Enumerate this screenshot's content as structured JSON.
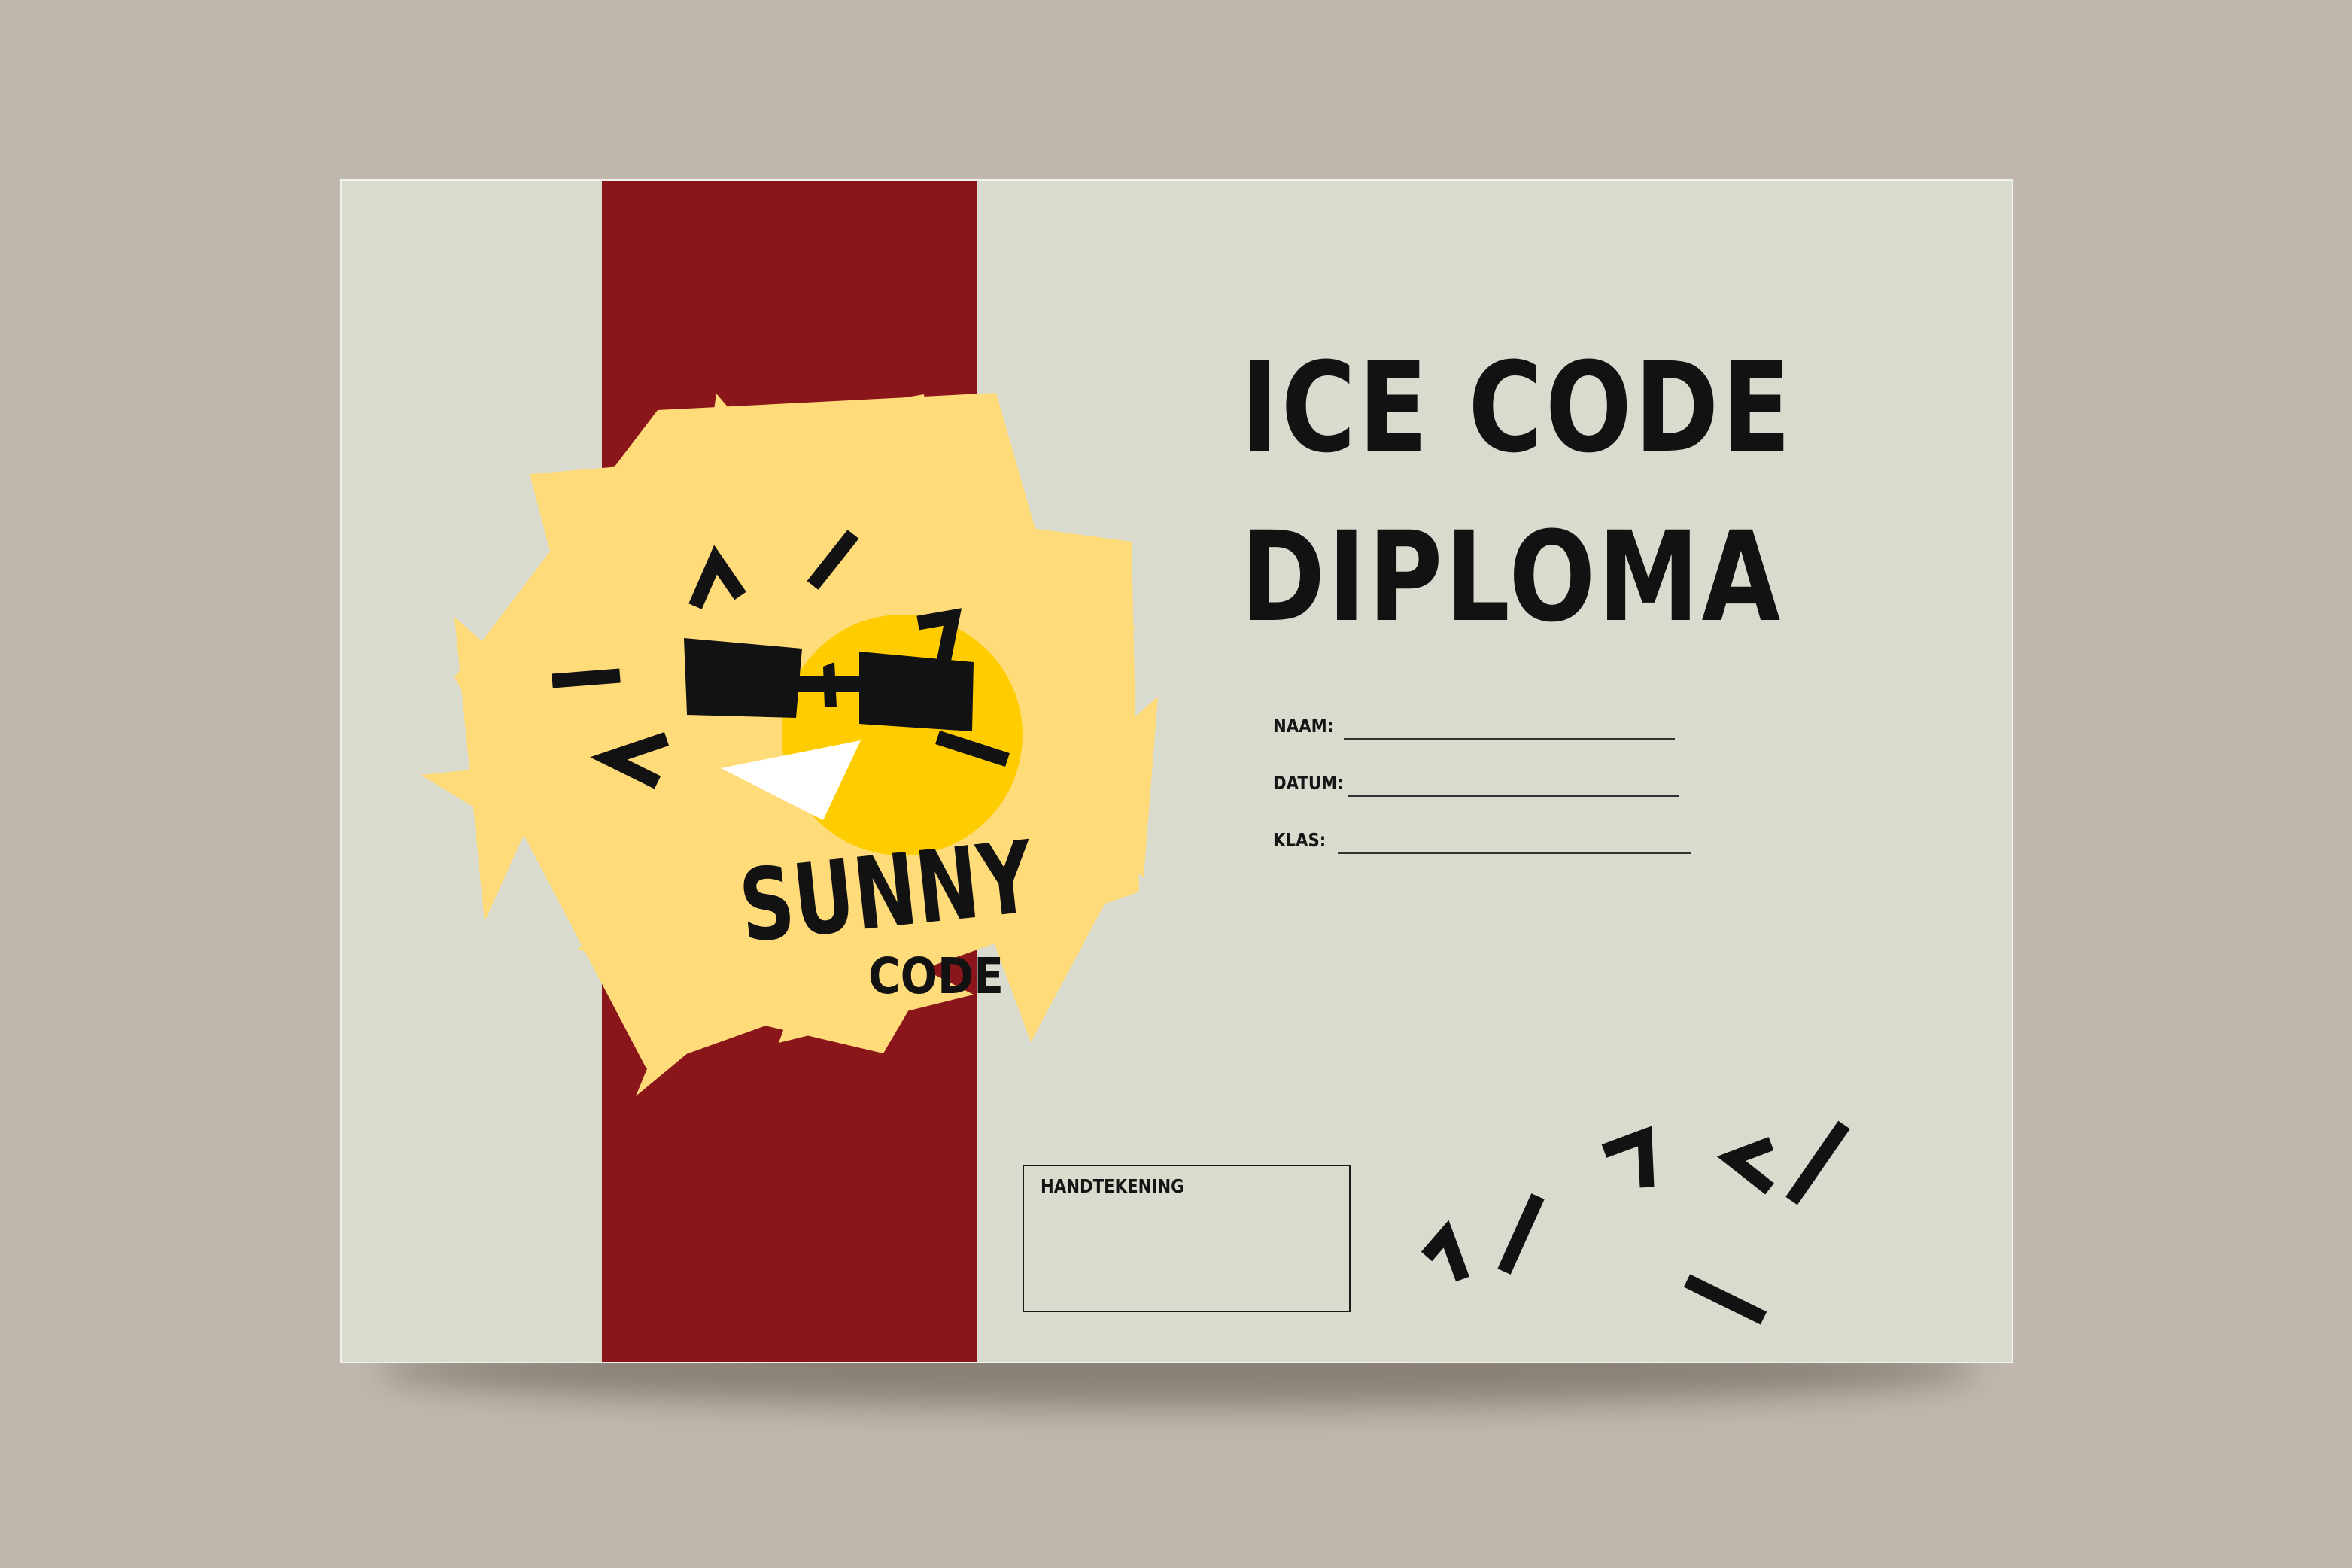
{
  "diploma": {
    "title_line1": "ICE CODE",
    "title_line2": "DIPLOMA",
    "fields": [
      {
        "label": "NAAM:"
      },
      {
        "label": "DATUM:"
      },
      {
        "label": "KLAS:"
      }
    ],
    "signature_label": "HANDTEKENING"
  },
  "logo": {
    "word1": "SUNNY",
    "word2": "CODE"
  },
  "colors": {
    "background": "#c0b8ae",
    "paper": "#d9dbcf",
    "ribbon": "#8a161c",
    "sun_petals": "#ffdb7a",
    "sun_face": "#ffcc00",
    "ink": "#121212"
  }
}
